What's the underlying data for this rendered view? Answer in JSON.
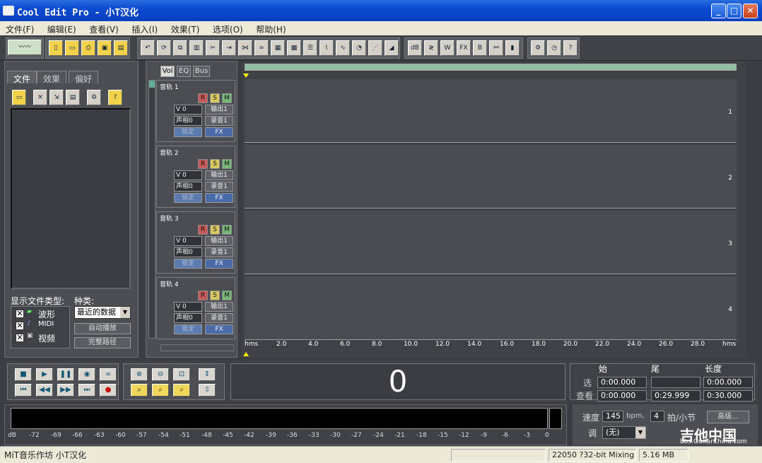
{
  "window": {
    "title": "Cool Edit Pro  - 小T汉化",
    "minimize": "_",
    "maximize": "□",
    "close": "✕"
  },
  "menu": [
    "文件(F)",
    "编辑(E)",
    "查看(V)",
    "插入(I)",
    "效果(T)",
    "选项(O)",
    "帮助(H)"
  ],
  "left_panel": {
    "tabs": [
      "文件",
      "效果",
      "偏好"
    ],
    "show_types_label": "显示文件类型:",
    "kind_label": "种类:",
    "types": [
      {
        "label": "波形",
        "checked": true
      },
      {
        "label": "MIDI",
        "checked": true
      },
      {
        "label": "视频",
        "checked": true
      }
    ],
    "kind_value": "最近的数据",
    "auto_play": "自动播放",
    "full_path": "完整路径"
  },
  "mixer_tabs": [
    "Vol",
    "EQ",
    "Bus"
  ],
  "tracks": [
    {
      "name": "音轨 1",
      "num": "1",
      "vol": "V 0",
      "pan": "声相0",
      "out": "输出1",
      "rec": "录音1",
      "lock": "锁定",
      "fx": "FX"
    },
    {
      "name": "音轨 2",
      "num": "2",
      "vol": "V 0",
      "pan": "声相0",
      "out": "输出1",
      "rec": "录音1",
      "lock": "锁定",
      "fx": "FX"
    },
    {
      "name": "音轨 3",
      "num": "3",
      "vol": "V 0",
      "pan": "声相0",
      "out": "输出1",
      "rec": "录音1",
      "lock": "锁定",
      "fx": "FX"
    },
    {
      "name": "音轨 4",
      "num": "4",
      "vol": "V 0",
      "pan": "声相0",
      "out": "输出1",
      "rec": "录音1",
      "lock": "锁定",
      "fx": "FX"
    }
  ],
  "ruler": [
    "hms",
    "2.0",
    "4.0",
    "6.0",
    "8.0",
    "10.0",
    "12.0",
    "14.0",
    "16.0",
    "18.0",
    "20.0",
    "22.0",
    "24.0",
    "26.0",
    "28.0",
    "hms"
  ],
  "timecode": "0",
  "selection": {
    "col_begin": "始",
    "col_end": "尾",
    "col_length": "长度",
    "sel_label": "选",
    "view_label": "查看",
    "sel_begin": "0:00.000",
    "sel_end": "",
    "sel_length": "0:00.000",
    "view_begin": "0:00.000",
    "view_end": "0:29.999",
    "view_length": "0:30.000"
  },
  "meter_ticks": [
    "dB",
    "-72",
    "-69",
    "-66",
    "-63",
    "-60",
    "-57",
    "-54",
    "-51",
    "-48",
    "-45",
    "-42",
    "-39",
    "-36",
    "-33",
    "-30",
    "-27",
    "-24",
    "-21",
    "-18",
    "-15",
    "-12",
    "-9",
    "-6",
    "-3",
    "0"
  ],
  "tempo": {
    "speed_label": "速度",
    "bpm": "145",
    "bpm_unit": "bpm,",
    "beats": "4",
    "beats_label": "拍/小节",
    "advanced": "高级...",
    "key_label": "调",
    "key_value": "(无)"
  },
  "status": {
    "left": "MiT音乐作坊 小T汉化",
    "format": "22050 ?32-bit Mixing",
    "size": "5.16 MB"
  },
  "watermark": {
    "big": "吉他中国",
    "small": "bbs.GuitarChina.com"
  }
}
